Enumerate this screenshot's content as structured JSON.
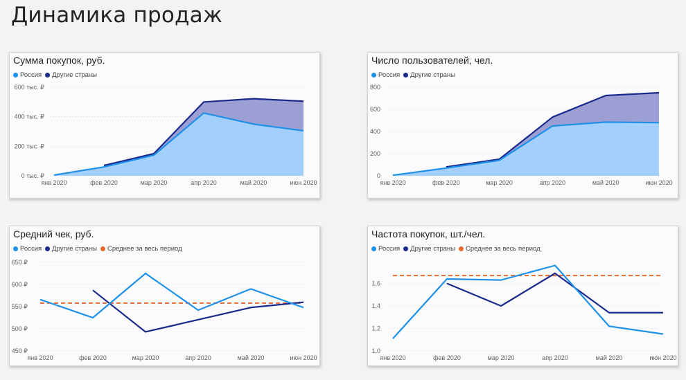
{
  "page": {
    "title": "Динамика продаж"
  },
  "colors": {
    "russia": "#1e90e8",
    "other": "#1a2a8c",
    "average": "#e56b2f",
    "russia_area": "#a2cffb",
    "other_area": "#9b9fd3"
  },
  "chart_data": [
    {
      "type": "area",
      "title": "Сумма покупок, руб.",
      "categories": [
        "янв 2020",
        "фев 2020",
        "мар 2020",
        "апр 2020",
        "май 2020",
        "июн 2020"
      ],
      "series": [
        {
          "name": "Россия",
          "values": [
            5000,
            60000,
            140000,
            425000,
            350000,
            305000
          ]
        },
        {
          "name": "Другие страны",
          "values": [
            null,
            70000,
            150000,
            500000,
            522000,
            505000
          ]
        }
      ],
      "ylim": [
        0,
        600000
      ],
      "yticks": [
        0,
        200000,
        400000,
        600000
      ],
      "ytick_labels": [
        "0 тыс. ₽",
        "200 тыс. ₽",
        "400 тыс. ₽",
        "600 тыс. ₽"
      ],
      "legend": [
        "Россия",
        "Другие страны"
      ],
      "grid": true
    },
    {
      "type": "area",
      "title": "Число пользователей, чел.",
      "categories": [
        "янв 2020",
        "фев 2020",
        "мар 2020",
        "апр 2020",
        "май 2020",
        "июн 2020"
      ],
      "series": [
        {
          "name": "Россия",
          "values": [
            5,
            70,
            140,
            450,
            485,
            480
          ]
        },
        {
          "name": "Другие страны",
          "values": [
            null,
            80,
            150,
            530,
            725,
            750
          ]
        }
      ],
      "ylim": [
        0,
        800
      ],
      "yticks": [
        0,
        200,
        400,
        600,
        800
      ],
      "ytick_labels": [
        "0",
        "200",
        "400",
        "600",
        "800"
      ],
      "legend": [
        "Россия",
        "Другие страны"
      ],
      "grid": true
    },
    {
      "type": "line",
      "title": "Средний чек, руб.",
      "categories": [
        "янв 2020",
        "фев 2020",
        "мар 2020",
        "апр 2020",
        "май 2020",
        "июн 2020"
      ],
      "series": [
        {
          "name": "Россия",
          "values": [
            566,
            525,
            625,
            542,
            590,
            548
          ]
        },
        {
          "name": "Другие страны",
          "values": [
            null,
            587,
            493,
            null,
            548,
            560
          ]
        }
      ],
      "average": 558,
      "ylim": [
        450,
        650
      ],
      "yticks": [
        450,
        500,
        550,
        600,
        650
      ],
      "ytick_labels": [
        "450 ₽",
        "500 ₽",
        "550 ₽",
        "600 ₽",
        "650 ₽"
      ],
      "legend": [
        "Россия",
        "Другие страны",
        "Среднее за весь период"
      ],
      "grid": true
    },
    {
      "type": "line",
      "title": "Частота покупок, шт./чел.",
      "categories": [
        "янв 2020",
        "фев 2020",
        "мар 2020",
        "апр 2020",
        "май 2020",
        "июн 2020"
      ],
      "series": [
        {
          "name": "Россия",
          "values": [
            1.11,
            1.64,
            1.63,
            1.76,
            1.22,
            1.15
          ]
        },
        {
          "name": "Другие страны",
          "values": [
            null,
            1.6,
            1.4,
            1.69,
            1.34,
            1.34
          ]
        }
      ],
      "average": 1.67,
      "ylim": [
        1.0,
        1.8
      ],
      "yticks": [
        1.0,
        1.2,
        1.4,
        1.6
      ],
      "ytick_labels": [
        "1,0",
        "1,2",
        "1,4",
        "1,6"
      ],
      "legend": [
        "Россия",
        "Другие страны",
        "Среднее за весь период"
      ],
      "grid": true
    }
  ]
}
